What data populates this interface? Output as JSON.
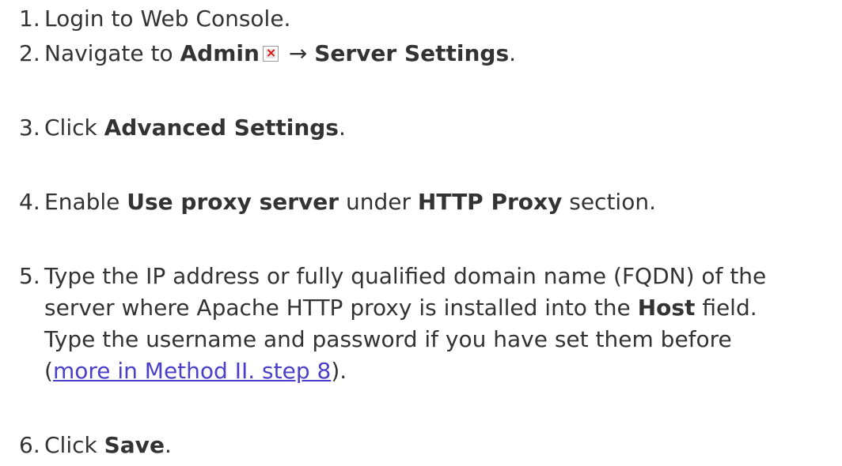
{
  "steps": [
    {
      "num": "1.",
      "text": "Login to Web Console."
    },
    {
      "num": "2.",
      "pre": "Navigate to ",
      "b1": "Admin",
      "icon": "broken-image-icon",
      "arrow": " → ",
      "b2": "Server Settings",
      "post": "."
    },
    {
      "num": "3.",
      "pre": "Click ",
      "b1": "Advanced Settings",
      "post": "."
    },
    {
      "num": "4.",
      "pre": "Enable ",
      "b1": "Use proxy server",
      "mid": " under ",
      "b2": "HTTP Proxy",
      "post": " section."
    },
    {
      "num": "5.",
      "line1": "Type the IP address or fully qualified domain name (FQDN) of the",
      "line2_pre": "server where Apache HTTP proxy is installed into the ",
      "line2_b": "Host",
      "line2_post": " field.",
      "line3": "Type the username and password if you have set them before",
      "line4_pre": "(",
      "link": "more in Method II. step 8",
      "line4_post": ")."
    },
    {
      "num": "6.",
      "pre": "Click ",
      "b1": "Save",
      "post": "."
    }
  ],
  "colors": {
    "text": "#333333",
    "link": "#4a3fc9"
  }
}
